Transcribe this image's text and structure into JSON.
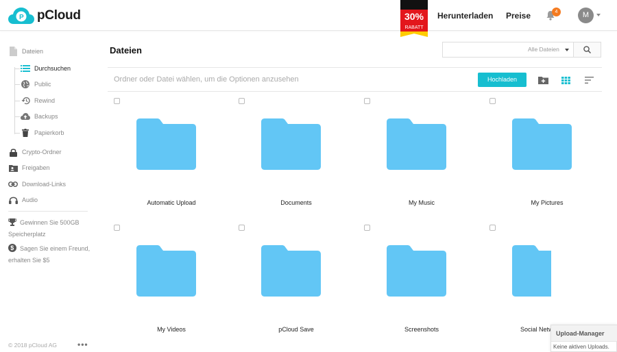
{
  "header": {
    "logo_text": "pCloud",
    "promo": {
      "percent": "30%",
      "label": "RABATT"
    },
    "nav": [
      {
        "label": "Herunterladen"
      },
      {
        "label": "Preise"
      }
    ],
    "notification_count": "4",
    "avatar_initial": "M"
  },
  "sidebar": {
    "section_title": "Dateien",
    "items": [
      {
        "label": "Durchsuchen",
        "icon": "list-icon",
        "active": true
      },
      {
        "label": "Public",
        "icon": "globe-icon"
      },
      {
        "label": "Rewind",
        "icon": "history-icon"
      },
      {
        "label": "Backups",
        "icon": "cloud-upload-icon"
      },
      {
        "label": "Papierkorb",
        "icon": "trash-icon"
      }
    ],
    "top_items": [
      {
        "label": "Crypto-Ordner",
        "icon": "lock-icon"
      },
      {
        "label": "Freigaben",
        "icon": "shared-folder-icon"
      },
      {
        "label": "Download-Links",
        "icon": "link-icon"
      },
      {
        "label": "Audio",
        "icon": "headphones-icon"
      }
    ],
    "promos": [
      {
        "text": "Gewinnen Sie 500GB Speicherplatz",
        "icon": "trophy-icon"
      },
      {
        "text": "Sagen Sie einem Freund, erhalten Sie $5",
        "icon": "dollar-icon"
      }
    ],
    "footer_copyright": "© 2018 pCloud AG",
    "footer_more": "•••"
  },
  "main": {
    "title": "Dateien",
    "search": {
      "placeholder": "",
      "scope": "Alle Dateien"
    },
    "hint": "Ordner oder Datei wählen, um die Optionen anzusehen",
    "upload_label": "Hochladen",
    "folders": [
      {
        "name": "Automatic Upload"
      },
      {
        "name": "Documents"
      },
      {
        "name": "My Music"
      },
      {
        "name": "My Pictures"
      },
      {
        "name": "My Videos"
      },
      {
        "name": "pCloud Save"
      },
      {
        "name": "Screenshots"
      },
      {
        "name": "Social Netw"
      }
    ]
  },
  "upload_manager": {
    "title": "Upload-Manager",
    "status": "Keine aktiven Uploads."
  },
  "colors": {
    "accent": "#17bed0",
    "folder": "#62c6f5",
    "promo_red": "#e3161c",
    "promo_yellow": "#ffcc00",
    "badge": "#f57b20"
  }
}
